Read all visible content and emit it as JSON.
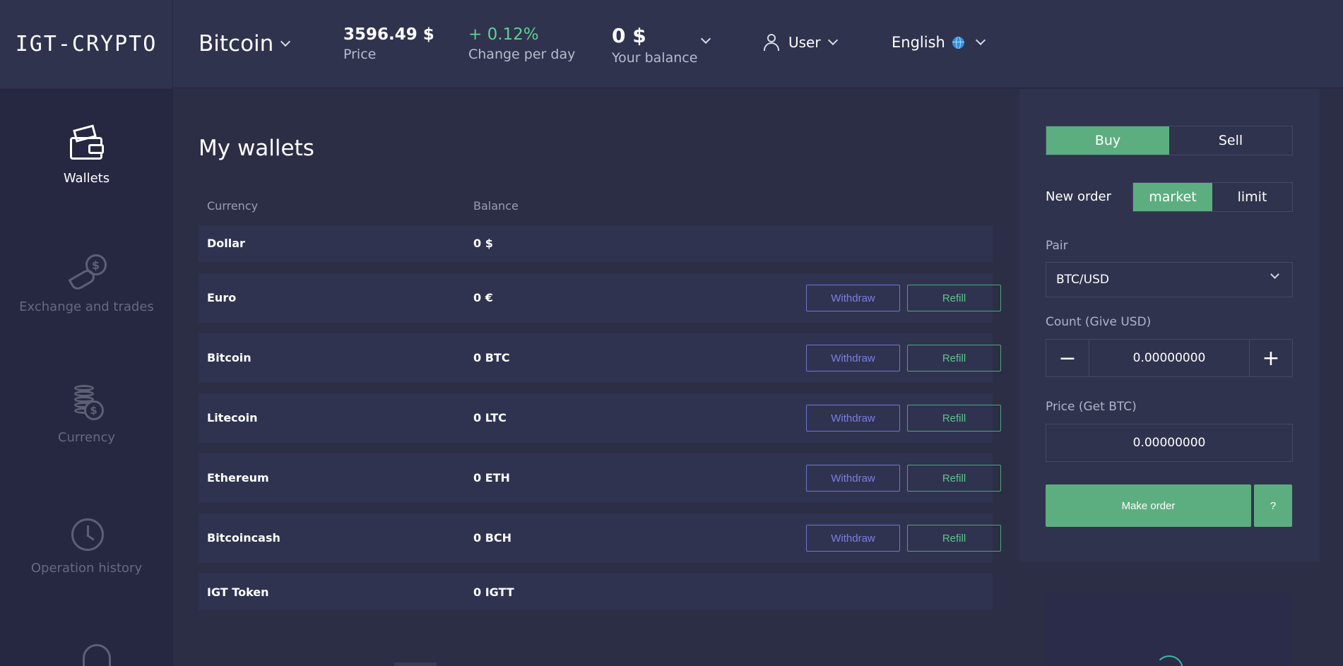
{
  "header": {
    "logo": "IGT-CRYPTO",
    "coin_select": "Bitcoin",
    "price_value": "3596.49 $",
    "price_label": "Price",
    "change_value": "+ 0.12%",
    "change_label": "Change per day",
    "balance_value": "0 $",
    "balance_label": "Your balance",
    "user_label": "User",
    "language": "English"
  },
  "sidebar": {
    "items": [
      {
        "label": "Wallets",
        "icon": "wallet-icon",
        "active": true
      },
      {
        "label": "Exchange and trades",
        "icon": "hand-coin-icon",
        "active": false
      },
      {
        "label": "Currency",
        "icon": "coin-stack-icon",
        "active": false
      },
      {
        "label": "Operation history",
        "icon": "clock-history-icon",
        "active": false
      }
    ]
  },
  "main": {
    "title": "My wallets",
    "columns": [
      "Currency",
      "Balance"
    ],
    "withdraw_label": "Withdraw",
    "refill_label": "Refill",
    "rows": [
      {
        "currency": "Dollar",
        "balance": "0 $"
      },
      {
        "currency": "Euro",
        "balance": "0 €"
      },
      {
        "currency": "Bitcoin",
        "balance": "0 BTC"
      },
      {
        "currency": "Litecoin",
        "balance": "0 LTC"
      },
      {
        "currency": "Ethereum",
        "balance": "0 ETH"
      },
      {
        "currency": "Bitcoincash",
        "balance": "0 BCH"
      },
      {
        "currency": "IGT Token",
        "balance": "0 IGTT"
      }
    ]
  },
  "order_panel": {
    "buy_label": "Buy",
    "sell_label": "Sell",
    "new_order_label": "New order",
    "market_label": "market",
    "limit_label": "limit",
    "pair_label": "Pair",
    "pair_value": "BTC/USD",
    "count_label": "Count (Give USD)",
    "count_value": "0.00000000",
    "price_label": "Price (Get BTC)",
    "price_value": "0.00000000",
    "make_order_label": "Make order",
    "help_label": "?",
    "minus_symbol": "−",
    "plus_symbol": "+"
  },
  "colors": {
    "accent_green": "#5cae80",
    "positive": "#5fcf93",
    "withdraw_purple": "#7a7fe0",
    "background": "#2b2e45"
  }
}
